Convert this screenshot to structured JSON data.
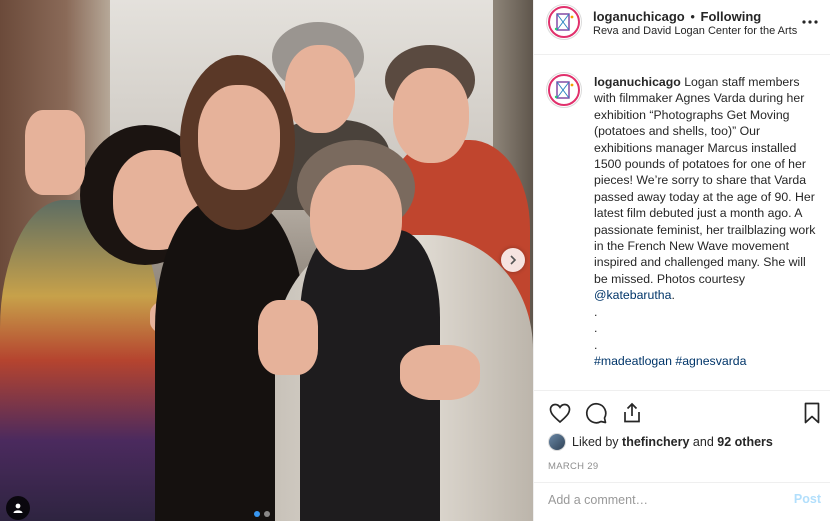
{
  "header": {
    "username": "loganuchicago",
    "separator": "•",
    "follow_status": "Following",
    "location": "Reva and David Logan Center for the Arts",
    "more_icon": "ellipsis-icon"
  },
  "caption": {
    "username": "loganuchicago",
    "text": "Logan staff members with filmmaker Agnes Varda during her exhibition “Photographs Get Moving (potatoes and shells, too)” Our exhibitions manager Marcus installed 1500 pounds of potatoes for one of her pieces! We’re sorry to share that Varda passed away today at the age of 90. Her latest film debuted just a month ago. A passionate feminist, her trailblazing work in the French New Wave movement inspired and challenged many. She will be missed. Photos courtesy",
    "mention": "@katebarutha",
    "suffix": ".",
    "dots": [
      ".",
      ".",
      "."
    ],
    "hashtags": "#madeatlogan #agnesvarda"
  },
  "likes": {
    "prefix": "Liked by",
    "user": "thefinchery",
    "and": "and",
    "others": "92 others"
  },
  "date": "MARCH 29",
  "comment": {
    "placeholder": "Add a comment…",
    "post_label": "Post"
  },
  "carousel": {
    "total": 2,
    "current": 1,
    "next_icon": "chevron-right-icon"
  },
  "colors": {
    "accent": "#3897f0",
    "post_disabled": "#b2dffc",
    "link": "#003569"
  }
}
